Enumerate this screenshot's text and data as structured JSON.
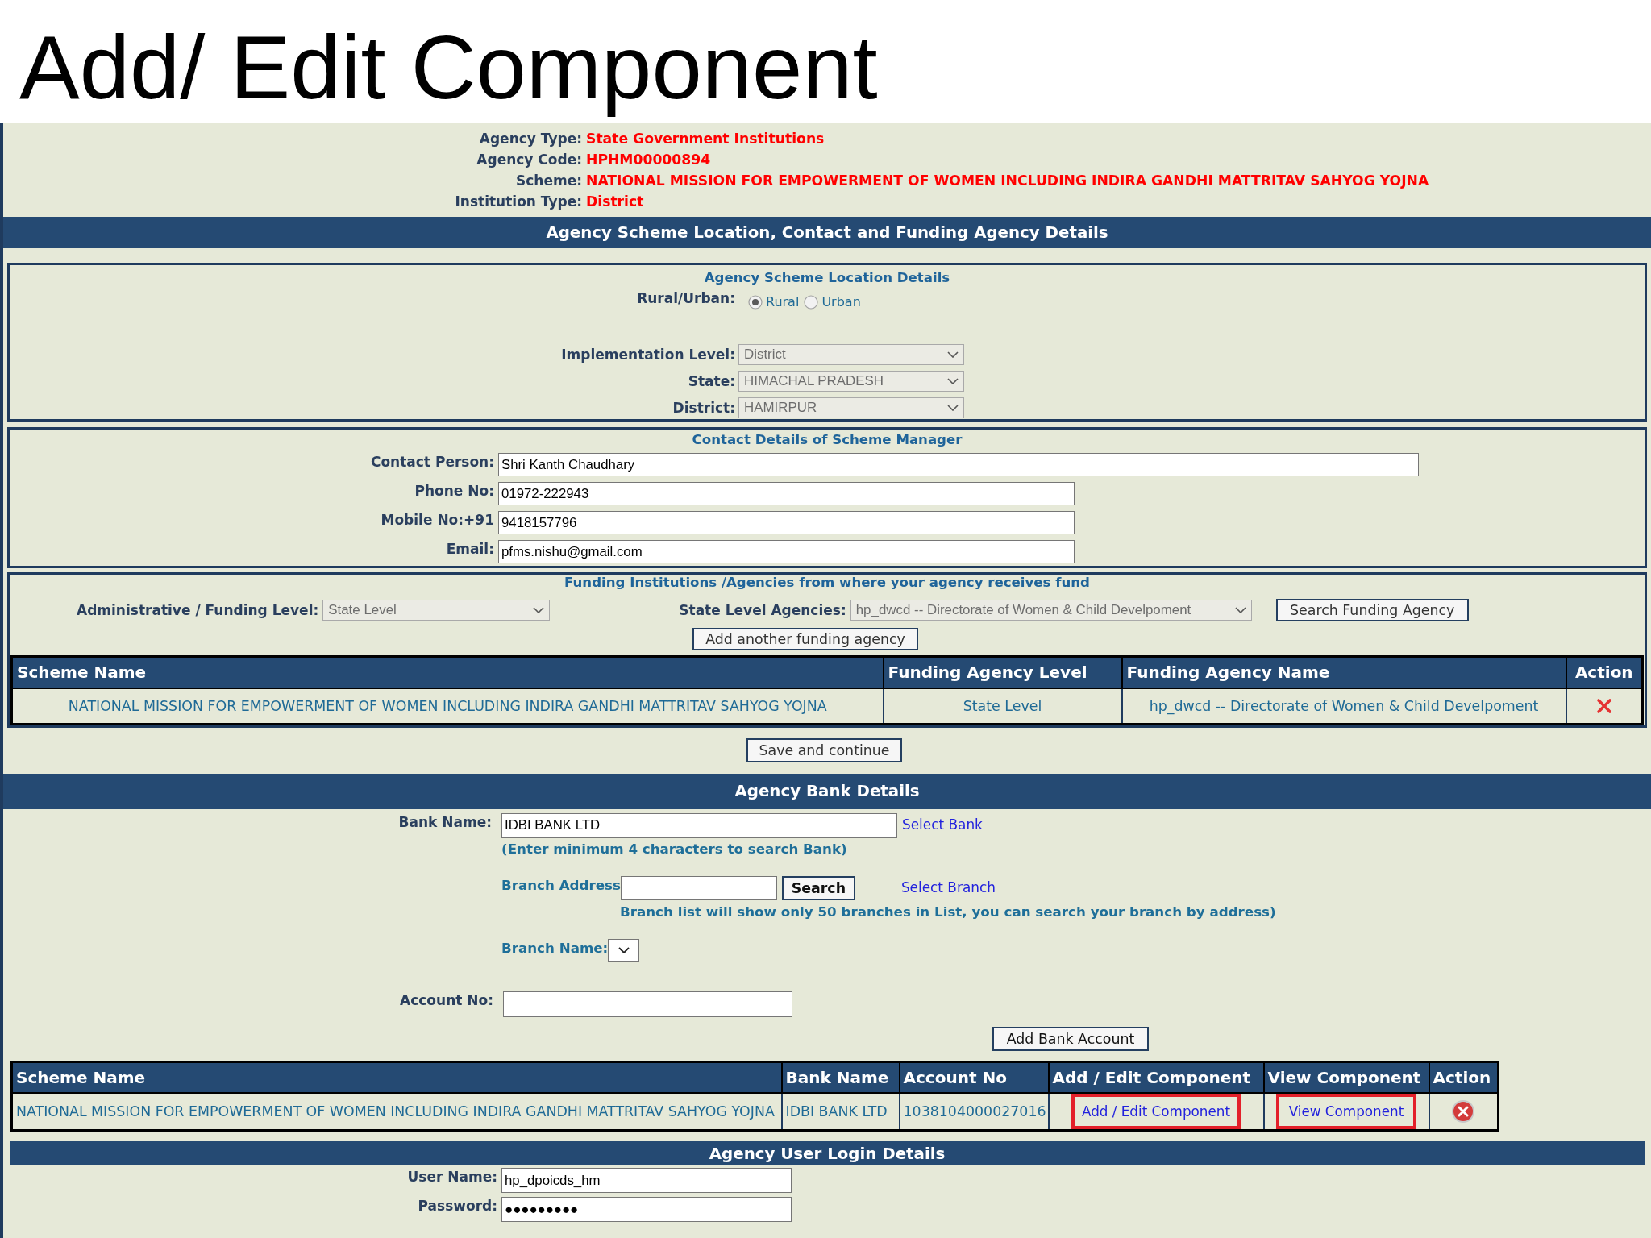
{
  "slide_title": "Add/ Edit Component",
  "agency_info": [
    {
      "label": "Agency Type:",
      "value": "State Government Institutions"
    },
    {
      "label": "Agency Code:",
      "value": "HPHM00000894"
    },
    {
      "label": "Scheme:",
      "value": "NATIONAL MISSION FOR EMPOWERMENT OF WOMEN INCLUDING INDIRA GANDHI MATTRITAV SAHYOG YOJNA"
    },
    {
      "label": "Institution Type:",
      "value": "District"
    }
  ],
  "details_section": {
    "title": "Agency Scheme Location, Contact and Funding Agency Details",
    "location": {
      "title": "Agency Scheme Location Details",
      "area_label": "Rural/Urban:",
      "area_options": [
        {
          "label": "Rural",
          "selected": true
        },
        {
          "label": "Urban",
          "selected": false
        }
      ],
      "selects": [
        {
          "label": "Implementation Level:",
          "value": "District",
          "disabled": true
        },
        {
          "label": "State:",
          "value": "HIMACHAL PRADESH",
          "disabled": true
        },
        {
          "label": "District:",
          "value": "HAMIRPUR",
          "disabled": true
        }
      ]
    },
    "contact": {
      "title": "Contact Details of Scheme Manager",
      "fields": [
        {
          "label": "Contact Person:",
          "value": "Shri Kanth Chaudhary",
          "kind": "wide"
        },
        {
          "label": "Phone No:",
          "value": "01972-222943",
          "kind": "normal"
        },
        {
          "label": "Mobile No:+91",
          "value": "9418157796",
          "kind": "normal"
        },
        {
          "label": "Email:",
          "value": "pfms.nishu@gmail.com",
          "kind": "normal"
        }
      ]
    },
    "funding": {
      "title": "Funding Institutions /Agencies from where your agency receives fund",
      "level_select": {
        "label": "Administrative / Funding Level:",
        "value": "State Level",
        "disabled": true
      },
      "agency_select": {
        "label": "State Level Agencies:",
        "value": "hp_dwcd -- Directorate of Women & Child Develpoment",
        "disabled": true
      },
      "search_button": "Search Funding Agency",
      "add_button": "Add another funding agency",
      "table": {
        "columns": [
          "Scheme Name",
          "Funding Agency Level",
          "Funding Agency Name",
          "Action"
        ],
        "rows": [
          {
            "scheme_name": "NATIONAL MISSION FOR EMPOWERMENT OF WOMEN INCLUDING INDIRA GANDHI MATTRITAV SAHYOG YOJNA",
            "funding_agency_level": "State Level",
            "funding_agency_name": "hp_dwcd -- Directorate of Women & Child Develpoment"
          }
        ]
      }
    }
  },
  "save_button": "Save and continue",
  "bank_section": {
    "title": "Agency Bank Details",
    "bank_name": {
      "label": "Bank Name:",
      "value": "IDBI BANK LTD"
    },
    "select_bank_link": "Select Bank",
    "bank_hint": "(Enter minimum 4 characters to search Bank)",
    "branch_address_label": "Branch Address",
    "search_button": "Search",
    "select_branch_link": "Select Branch",
    "branch_hint": "Branch list will show only 50 branches in List, you can search your branch by address)",
    "branch_name": {
      "label": "Branch Name:",
      "disabled": false
    },
    "account_no_label": "Account No:",
    "add_button": "Add Bank Account",
    "table": {
      "columns": [
        "Scheme Name",
        "Bank Name",
        "Account No",
        "Add / Edit Component",
        "View Component",
        "Action"
      ],
      "rows": [
        {
          "scheme_name": "NATIONAL MISSION FOR EMPOWERMENT OF WOMEN INCLUDING INDIRA GANDHI MATTRITAV SAHYOG YOJNA",
          "bank_name": "IDBI BANK LTD",
          "account_no": "1038104000027016",
          "edit_link": {
            "label": "Add / Edit Component",
            "highlighted": true
          },
          "view_link": {
            "label": "View Component",
            "highlighted": true
          }
        }
      ]
    }
  },
  "login_section": {
    "title": "Agency User Login Details",
    "fields": [
      {
        "label": "User Name:",
        "value": "hp_dpoicds_hm"
      },
      {
        "label": "Password:",
        "value": "●●●●●●●●●"
      }
    ]
  }
}
